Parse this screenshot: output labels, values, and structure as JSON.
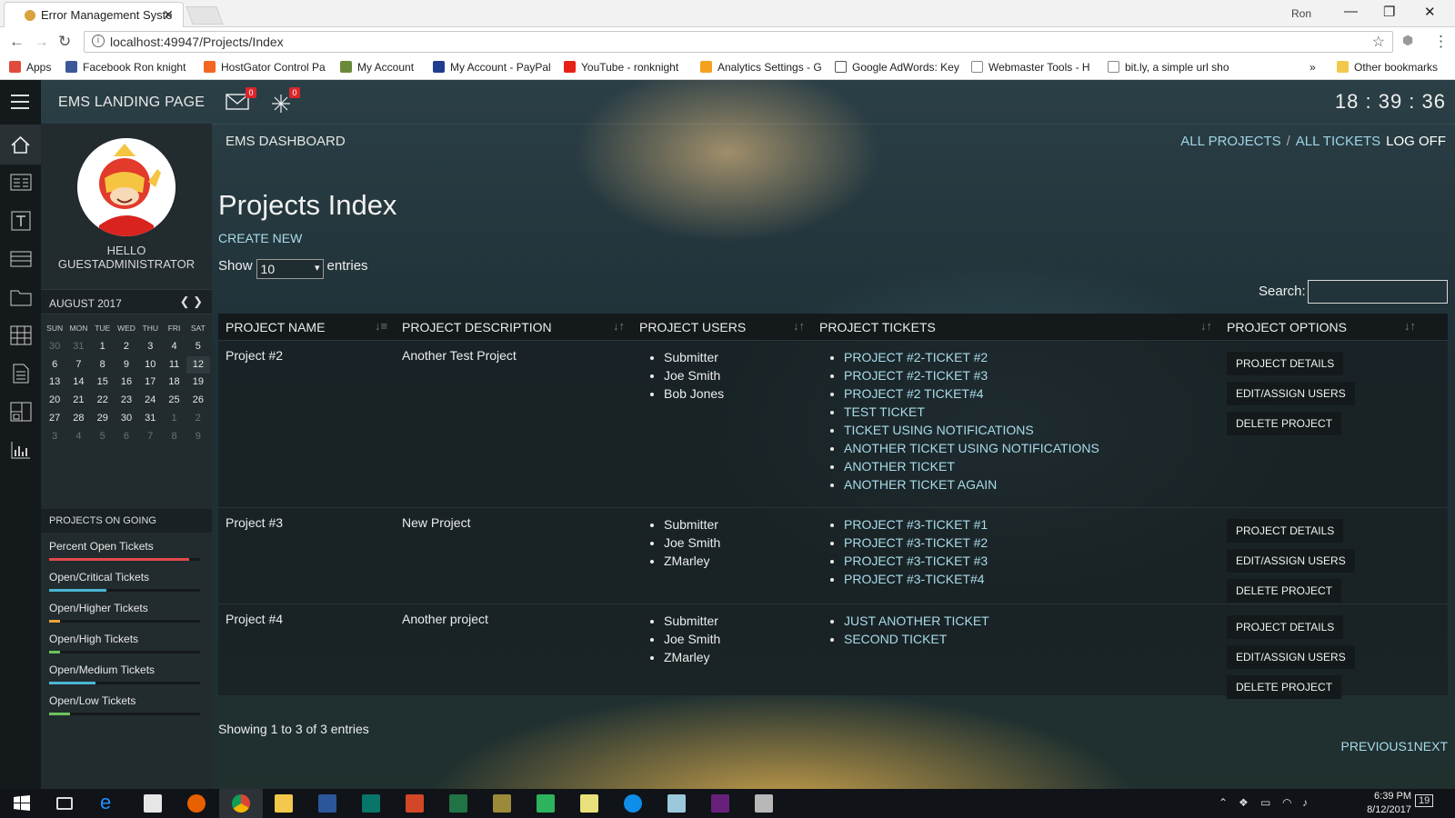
{
  "browser": {
    "tab_title": "Error Management Syste",
    "user": "Ron",
    "url": "localhost:49947/Projects/Index",
    "bookmarks": [
      {
        "label": "Apps",
        "color": "#e04a3f"
      },
      {
        "label": "Facebook Ron knight",
        "color": "#3b5998"
      },
      {
        "label": "HostGator Control Pa",
        "color": "#f26522"
      },
      {
        "label": "My Account",
        "color": "#6a8a3a"
      },
      {
        "label": "My Account - PayPal",
        "color": "#1f3d8f"
      },
      {
        "label": "YouTube - ronknight",
        "color": "#e62117"
      },
      {
        "label": "Analytics Settings - G",
        "color": "#f4a11e"
      },
      {
        "label": "Google AdWords: Key",
        "color": "#555555"
      },
      {
        "label": "Webmaster Tools - H",
        "color": "#888888"
      },
      {
        "label": "bit.ly, a simple url sho",
        "color": "#888888"
      }
    ],
    "more_bookmarks": "»",
    "other_bookmarks": "Other bookmarks"
  },
  "app": {
    "brand": "EMS LANDING PAGE",
    "mail_badge": "0",
    "alert_badge": "0",
    "clock": "18 : 39 : 36",
    "dashboard": "EMS DASHBOARD",
    "nav": {
      "all_projects": "ALL PROJECTS",
      "sep": "/",
      "all_tickets": "ALL TICKETS",
      "log_off": "LOG OFF"
    }
  },
  "sidebar": {
    "hello": "HELLO",
    "username": "GUESTADMINISTRATOR",
    "calendar": {
      "month": "AUGUST 2017",
      "dow": [
        "SUN",
        "MON",
        "TUE",
        "WED",
        "THU",
        "FRI",
        "SAT"
      ],
      "weeks": [
        [
          "30",
          "31",
          "1",
          "2",
          "3",
          "4",
          "5"
        ],
        [
          "6",
          "7",
          "8",
          "9",
          "10",
          "11",
          "12"
        ],
        [
          "13",
          "14",
          "15",
          "16",
          "17",
          "18",
          "19"
        ],
        [
          "20",
          "21",
          "22",
          "23",
          "24",
          "25",
          "26"
        ],
        [
          "27",
          "28",
          "29",
          "30",
          "31",
          "1",
          "2"
        ],
        [
          "3",
          "4",
          "5",
          "6",
          "7",
          "8",
          "9"
        ]
      ]
    },
    "projects_heading": "PROJECTS ON GOING",
    "stats": [
      {
        "label": "Percent Open Tickets",
        "value": 0.93,
        "color": "#e04a4a"
      },
      {
        "label": "Open/Critical Tickets",
        "value": 0.38,
        "color": "#4ab6d4"
      },
      {
        "label": "Open/Higher Tickets",
        "value": 0.07,
        "color": "#e8a33a"
      },
      {
        "label": "Open/High Tickets",
        "value": 0.07,
        "color": "#6cc35c"
      },
      {
        "label": "Open/Medium Tickets",
        "value": 0.31,
        "color": "#4ab6d4"
      },
      {
        "label": "Open/Low Tickets",
        "value": 0.14,
        "color": "#6cc35c"
      }
    ]
  },
  "main": {
    "title": "Projects Index",
    "create_new": "CREATE NEW",
    "show_label": "Show",
    "entries_value": "10",
    "entries_label": "entries",
    "search_label": "Search:",
    "columns": [
      "PROJECT NAME",
      "PROJECT DESCRIPTION",
      "PROJECT USERS",
      "PROJECT TICKETS",
      "PROJECT OPTIONS"
    ],
    "rows": [
      {
        "name": "Project #2",
        "description": "Another Test Project",
        "users": [
          "Submitter",
          "Joe Smith",
          "Bob Jones"
        ],
        "tickets": [
          "PROJECT #2-TICKET #2",
          "PROJECT #2-TICKET #3",
          "PROJECT #2 TICKET#4",
          "TEST TICKET",
          "TICKET USING NOTIFICATIONS",
          "ANOTHER TICKET USING NOTIFICATIONS",
          "ANOTHER TICKET",
          "ANOTHER TICKET AGAIN"
        ]
      },
      {
        "name": "Project #3",
        "description": "New Project",
        "users": [
          "Submitter",
          "Joe Smith",
          "ZMarley"
        ],
        "tickets": [
          "PROJECT #3-TICKET #1",
          "PROJECT #3-TICKET #2",
          "PROJECT #3-TICKET #3",
          "PROJECT #3-TICKET#4"
        ]
      },
      {
        "name": "Project #4",
        "description": "Another project",
        "users": [
          "Submitter",
          "Joe Smith",
          "ZMarley"
        ],
        "tickets": [
          "JUST ANOTHER TICKET",
          "SECOND TICKET"
        ]
      }
    ],
    "options": [
      "PROJECT DETAILS",
      "EDIT/ASSIGN USERS",
      "DELETE PROJECT"
    ],
    "showing": "Showing 1 to 3 of 3 entries",
    "pager": {
      "previous": "PREVIOUS",
      "page": "1",
      "next": "NEXT"
    }
  },
  "taskbar": {
    "time": "6:39 PM",
    "date": "8/12/2017",
    "notifications": "19"
  }
}
